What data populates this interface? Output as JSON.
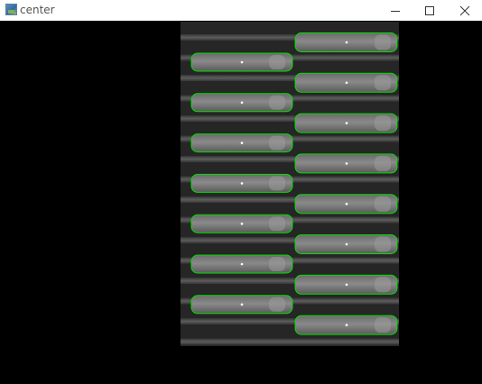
{
  "window": {
    "title": "center",
    "icon": "app-image-icon",
    "controls": [
      "minimize-icon",
      "maximize-icon",
      "close-icon"
    ]
  },
  "canvas": {
    "background": "#000000",
    "image_background": "#262626",
    "contour_color": "#00e000",
    "center_marker_color": "#ffffff",
    "contours": {
      "left_column_count": 7,
      "right_column_count": 8
    }
  }
}
